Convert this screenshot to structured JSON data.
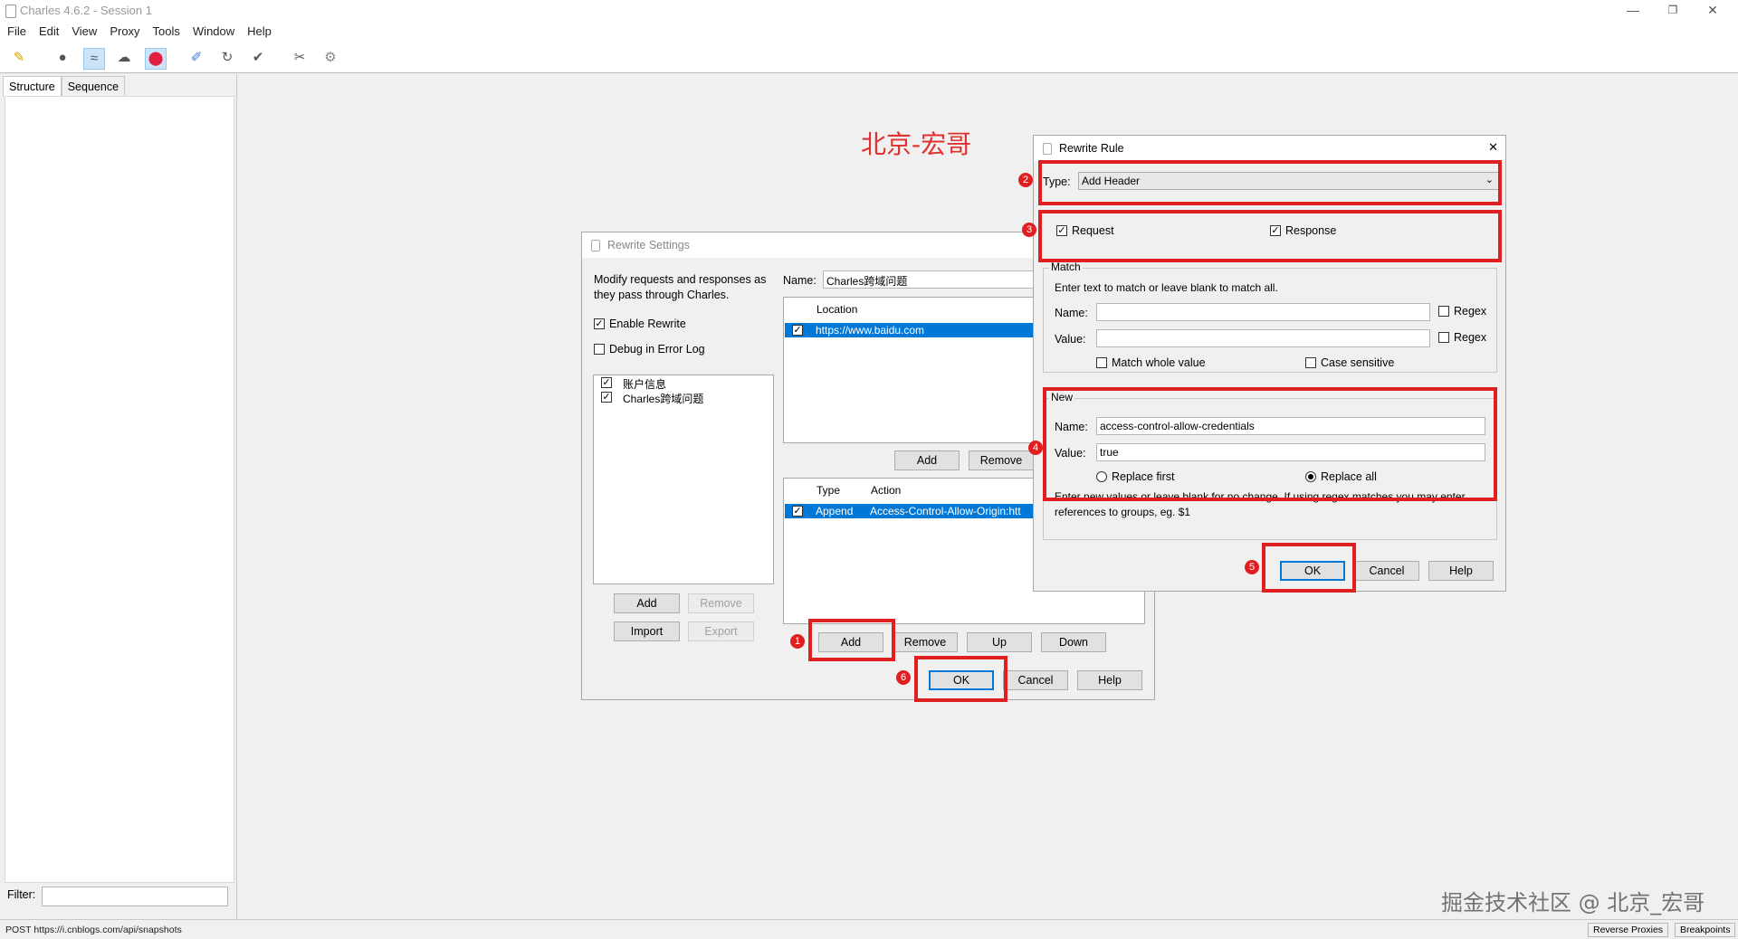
{
  "window": {
    "title": "Charles 4.6.2 - Session 1",
    "minimize": "—",
    "restore": "❐",
    "close": "✕"
  },
  "menu": [
    "File",
    "Edit",
    "View",
    "Proxy",
    "Tools",
    "Window",
    "Help"
  ],
  "toolbar_icons": [
    "broom-icon",
    "record-icon",
    "throttle-icon",
    "turtle-icon",
    "breakpoint-icon",
    "compose-icon",
    "repeat-icon",
    "validate-icon",
    "tools-icon",
    "settings-icon"
  ],
  "left": {
    "tabs": [
      "Structure",
      "Sequence"
    ],
    "filter_label": "Filter:"
  },
  "status": {
    "text": "POST https://i.cnblogs.com/api/snapshots",
    "reverse_proxies": "Reverse Proxies",
    "breakpoints": "Breakpoints"
  },
  "overlay_title": "北京-宏哥",
  "watermark": "掘金技术社区 @ 北京_宏哥",
  "rewrite_settings": {
    "title": "Rewrite Settings",
    "description": "Modify requests and responses as they pass through Charles.",
    "enable_rewrite": "Enable Rewrite",
    "debug_log": "Debug in Error Log",
    "sets": [
      "账户信息",
      "Charles跨域问题"
    ],
    "add": "Add",
    "remove": "Remove",
    "import": "Import",
    "export": "Export",
    "name_label": "Name:",
    "name_value": "Charles跨域问题",
    "location_header": "Location",
    "locations": [
      "https://www.baidu.com"
    ],
    "loc_add": "Add",
    "loc_remove": "Remove",
    "rules_headers": {
      "type": "Type",
      "action": "Action"
    },
    "rules": [
      {
        "type": "Append",
        "action": "Access-Control-Allow-Origin:htt"
      }
    ],
    "rule_add": "Add",
    "rule_remove": "Remove",
    "rule_up": "Up",
    "rule_down": "Down",
    "ok": "OK",
    "cancel": "Cancel",
    "help": "Help"
  },
  "rewrite_rule": {
    "title": "Rewrite Rule",
    "close": "✕",
    "type_label": "Type:",
    "type_value": "Add Header",
    "request": "Request",
    "response": "Response",
    "match_legend": "Match",
    "match_hint": "Enter text to match or leave blank to match all.",
    "name_label": "Name:",
    "value_label": "Value:",
    "regex": "Regex",
    "match_whole": "Match whole value",
    "case_sensitive": "Case sensitive",
    "new_legend": "New",
    "new_name_value": "access-control-allow-credentials",
    "new_value_value": "true",
    "replace_first": "Replace first",
    "replace_all": "Replace all",
    "new_hint": "Enter new values or leave blank for no change. If using regex matches you may enter references to groups, eg. $1",
    "ok": "OK",
    "cancel": "Cancel",
    "help": "Help"
  },
  "badges": [
    "1",
    "2",
    "3",
    "4",
    "5",
    "6"
  ],
  "colors": {
    "annotation_red": "#e02020",
    "selection_blue": "#0078d7"
  }
}
